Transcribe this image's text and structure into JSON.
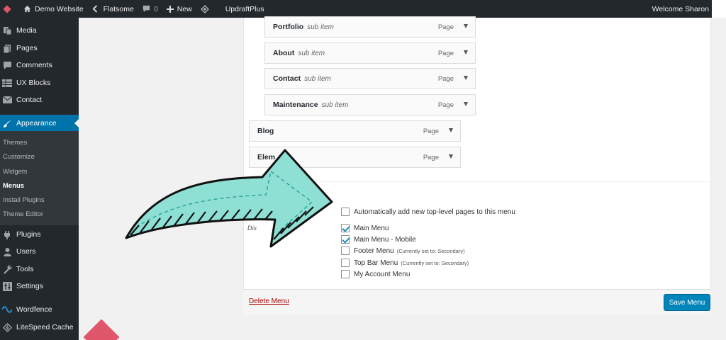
{
  "admin_bar": {
    "site_name": "Demo Website",
    "theme_name": "Flatsome",
    "comments_count": "0",
    "new_label": "New",
    "plugin_label": "UpdraftPlus",
    "welcome": "Welcome Sharon"
  },
  "sidebar": {
    "items": [
      {
        "label": "Media",
        "icon": "media-icon"
      },
      {
        "label": "Pages",
        "icon": "pages-icon"
      },
      {
        "label": "Comments",
        "icon": "comments-icon"
      },
      {
        "label": "UX Blocks",
        "icon": "ux-blocks-icon"
      },
      {
        "label": "Contact",
        "icon": "mail-icon"
      },
      {
        "label": "Appearance",
        "icon": "brush-icon"
      },
      {
        "label": "Plugins",
        "icon": "plugin-icon"
      },
      {
        "label": "Users",
        "icon": "users-icon"
      },
      {
        "label": "Tools",
        "icon": "wrench-icon"
      },
      {
        "label": "Settings",
        "icon": "settings-icon"
      },
      {
        "label": "Wordfence",
        "icon": "wordfence-icon"
      },
      {
        "label": "LiteSpeed Cache",
        "icon": "litespeed-icon"
      }
    ],
    "appearance_submenu": [
      "Themes",
      "Customize",
      "Widgets",
      "Menus",
      "Install Plugins",
      "Theme Editor"
    ],
    "current_submenu": "Menus"
  },
  "menu_items": [
    {
      "title": "Portfolio",
      "subtitle": "sub item",
      "type": "Page"
    },
    {
      "title": "About",
      "subtitle": "sub item",
      "type": "Page"
    },
    {
      "title": "Contact",
      "subtitle": "sub item",
      "type": "Page"
    },
    {
      "title": "Maintenance",
      "subtitle": "sub item",
      "type": "Page"
    },
    {
      "title": "Blog",
      "subtitle": "",
      "type": "Page"
    },
    {
      "title": "Elem",
      "subtitle": "",
      "type": "Page"
    }
  ],
  "menu_settings": {
    "display_location_fragment": "Dis",
    "auto_add_label": "Automatically add new top-level pages to this menu",
    "auto_add_checked": false,
    "locations": [
      {
        "label": "Main Menu",
        "checked": true,
        "note": ""
      },
      {
        "label": "Main Menu - Mobile",
        "checked": true,
        "note": ""
      },
      {
        "label": "Footer Menu",
        "checked": false,
        "note": "(Currently set to: Secondary)"
      },
      {
        "label": "Top Bar Menu",
        "checked": false,
        "note": "(Currently set to: Secondary)"
      },
      {
        "label": "My Account Menu",
        "checked": false,
        "note": ""
      }
    ]
  },
  "actions": {
    "delete_label": "Delete Menu",
    "save_label": "Save Menu"
  },
  "colors": {
    "admin_dark": "#23282d",
    "accent_blue": "#0073aa",
    "delete_red": "#a00000",
    "arrow_teal": "#8fe0d4"
  }
}
